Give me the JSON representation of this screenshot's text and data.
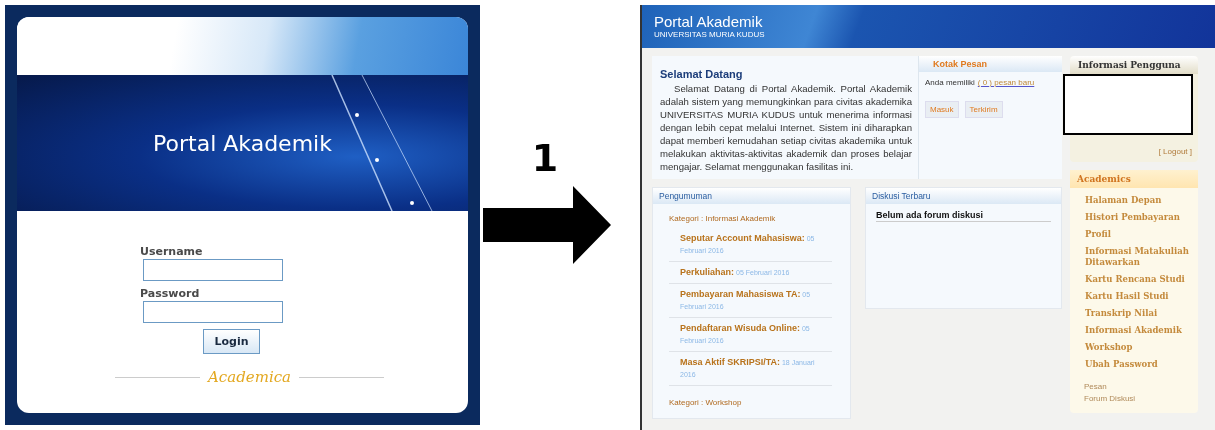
{
  "login_screen": {
    "title": "Portal Akademik",
    "fields": [
      {
        "label": "Username"
      },
      {
        "label": "Password"
      }
    ],
    "button": "Login",
    "footer_logo": "Academica"
  },
  "step_arrow": {
    "label": "1"
  },
  "portal_screen": {
    "header": {
      "title": "Portal Akademik",
      "subtitle": "UNIVERSITAS MURIA KUDUS"
    },
    "welcome": {
      "title": "Selamat Datang",
      "text": "Selamat Datang di Portal Akademik. Portal Akademik adalah sistem yang memungkinkan para civitas akademika UNIVERSITAS MURIA KUDUS untuk menerima informasi dengan lebih cepat melalui Internet. Sistem ini diharapkan dapat memberi kemudahan setiap civitas akademika untuk melakukan aktivitas-aktivitas akademik dan proses belajar mengajar. Selamat menggunakan fasilitas ini."
    },
    "inbox": {
      "title": "Kotak Pesan",
      "message_prefix": "Anda memiliki",
      "message_link": "( 0 ) pesan baru",
      "buttons": [
        "Masuk",
        "Terkirim"
      ]
    },
    "announcements": {
      "title": "Pengumuman",
      "categories": [
        {
          "name": "Kategori : Informasi Akademik",
          "items": [
            {
              "title": "Seputar Account Mahasiswa:",
              "date": "05 Februari 2016"
            },
            {
              "title": "Perkuliahan:",
              "date": "05 Februari 2016"
            },
            {
              "title": "Pembayaran Mahasiswa TA:",
              "date": "05 Februari 2016"
            },
            {
              "title": "Pendaftaran Wisuda Online:",
              "date": "05 Februari 2016"
            },
            {
              "title": "Masa Aktif SKRIPSI/TA:",
              "date": "18 Januari 2016"
            }
          ]
        },
        {
          "name": "Kategori : Workshop"
        }
      ]
    },
    "discussion": {
      "title": "Diskusi Terbaru",
      "empty_text": "Belum ada forum diskusi"
    },
    "user_info": {
      "title": "Informasi Pengguna",
      "logout": "[ Logout ]"
    },
    "academics_menu": {
      "title": "Academics",
      "items": [
        "Halaman Depan",
        "Histori Pembayaran",
        "Profil",
        "Informasi Matakuliah Ditawarkan",
        "Kartu Rencana Studi",
        "Kartu Hasil Studi",
        "Transkrip Nilai",
        "Informasi Akademik",
        "Workshop",
        "Ubah Password"
      ],
      "extra_links": [
        "Pesan",
        "Forum Diskusi"
      ]
    }
  }
}
